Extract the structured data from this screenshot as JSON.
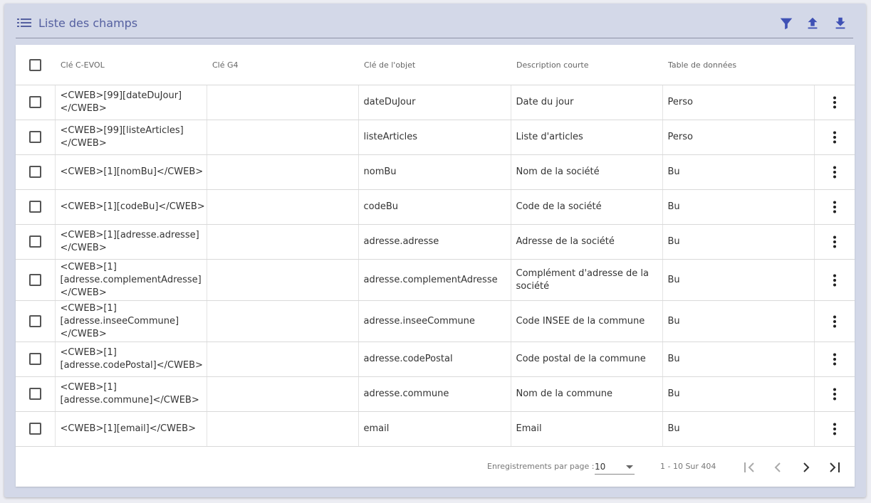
{
  "header": {
    "title": "Liste des champs",
    "icons": [
      "list-icon",
      "filter-icon",
      "upload-icon",
      "download-icon"
    ]
  },
  "table": {
    "columns": [
      "Clé C-EVOL",
      "Clé G4",
      "Clé de l'objet",
      "Description courte",
      "Table de données"
    ],
    "rows": [
      {
        "cle_cevol": "<CWEB>[99][dateDuJour]</CWEB>",
        "cle_g4": "",
        "cle_objet": "dateDuJour",
        "description": "Date du jour",
        "table": "Perso"
      },
      {
        "cle_cevol": "<CWEB>[99][listeArticles]</CWEB>",
        "cle_g4": "",
        "cle_objet": "listeArticles",
        "description": "Liste d'articles",
        "table": "Perso"
      },
      {
        "cle_cevol": "<CWEB>[1][nomBu]</CWEB>",
        "cle_g4": "",
        "cle_objet": "nomBu",
        "description": "Nom de la société",
        "table": "Bu"
      },
      {
        "cle_cevol": "<CWEB>[1][codeBu]</CWEB>",
        "cle_g4": "",
        "cle_objet": "codeBu",
        "description": "Code de la société",
        "table": "Bu"
      },
      {
        "cle_cevol": "<CWEB>[1][adresse.adresse]</CWEB>",
        "cle_g4": "",
        "cle_objet": "adresse.adresse",
        "description": "Adresse de la société",
        "table": "Bu"
      },
      {
        "cle_cevol": "<CWEB>[1][adresse.complementAdresse]</CWEB>",
        "cle_g4": "",
        "cle_objet": "adresse.complementAdresse",
        "description": "Complément d'adresse de la société",
        "table": "Bu"
      },
      {
        "cle_cevol": "<CWEB>[1][adresse.inseeCommune]</CWEB>",
        "cle_g4": "",
        "cle_objet": "adresse.inseeCommune",
        "description": "Code INSEE de la commune",
        "table": "Bu"
      },
      {
        "cle_cevol": "<CWEB>[1][adresse.codePostal]</CWEB>",
        "cle_g4": "",
        "cle_objet": "adresse.codePostal",
        "description": "Code postal de la commune",
        "table": "Bu"
      },
      {
        "cle_cevol": "<CWEB>[1][adresse.commune]</CWEB>",
        "cle_g4": "",
        "cle_objet": "adresse.commune",
        "description": "Nom de la commune",
        "table": "Bu"
      },
      {
        "cle_cevol": "<CWEB>[1][email]</CWEB>",
        "cle_g4": "",
        "cle_objet": "email",
        "description": "Email",
        "table": "Bu"
      }
    ]
  },
  "pagination": {
    "per_page_label": "Enregistrements par page :",
    "per_page_value": "10",
    "range": "1 - 10 Sur 404"
  },
  "colors": {
    "panel_bg": "#d3d8e8",
    "accent": "#5560a0",
    "icon_accent": "#3f51b5"
  }
}
